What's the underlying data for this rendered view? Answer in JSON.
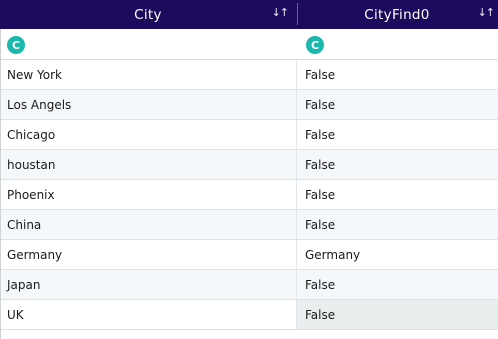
{
  "columns": [
    {
      "label": "City",
      "sort_icon": "sort-arrows-icon",
      "type_badge": "C"
    },
    {
      "label": "CityFind0",
      "sort_icon": "sort-arrows-icon",
      "type_badge": "C"
    }
  ],
  "sort_glyph": "↓↑",
  "rows": [
    {
      "city": "New York",
      "find": "False"
    },
    {
      "city": "Los Angels",
      "find": "False"
    },
    {
      "city": "Chicago",
      "find": "False"
    },
    {
      "city": "houstan",
      "find": "False"
    },
    {
      "city": "Phoenix",
      "find": "False"
    },
    {
      "city": "China",
      "find": "False"
    },
    {
      "city": "Germany",
      "find": "Germany"
    },
    {
      "city": "Japan",
      "find": "False"
    },
    {
      "city": "UK",
      "find": "False"
    }
  ],
  "colors": {
    "header_bg": "#1e0a5c",
    "type_badge": "#1ab7ad",
    "selected_cell": "#e9eeee"
  }
}
